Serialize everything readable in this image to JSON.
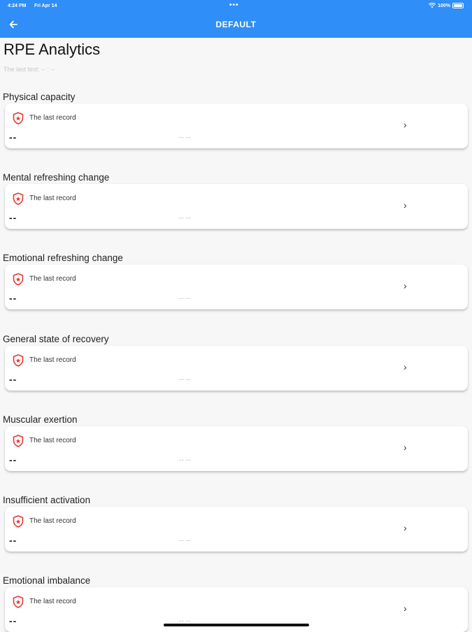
{
  "status_bar": {
    "time": "4:24 PM",
    "date": "Fri Apr 14",
    "battery": "100%"
  },
  "header": {
    "title": "DEFAULT"
  },
  "page": {
    "title": "RPE Analytics",
    "last_test": "The last test:  -- : --"
  },
  "sections": [
    {
      "title": "Physical capacity",
      "record_label": "The last record",
      "value": "--",
      "time": "-- --"
    },
    {
      "title": "Mental refreshing change",
      "record_label": "The last record",
      "value": "--",
      "time": "-- --"
    },
    {
      "title": "Emotional refreshing change",
      "record_label": "The last record",
      "value": "--",
      "time": "-- --"
    },
    {
      "title": "General state of recovery",
      "record_label": "The last record",
      "value": "--",
      "time": "-- --"
    },
    {
      "title": "Muscular exertion",
      "record_label": "The last record",
      "value": "--",
      "time": "-- --"
    },
    {
      "title": "Insufficient activation",
      "record_label": "The last record",
      "value": "--",
      "time": "-- --"
    },
    {
      "title": "Emotional imbalance",
      "record_label": "The last record",
      "value": "--",
      "time": "-- --"
    }
  ],
  "colors": {
    "header_bg": "#2f8ef7",
    "icon_red": "#e53935"
  }
}
